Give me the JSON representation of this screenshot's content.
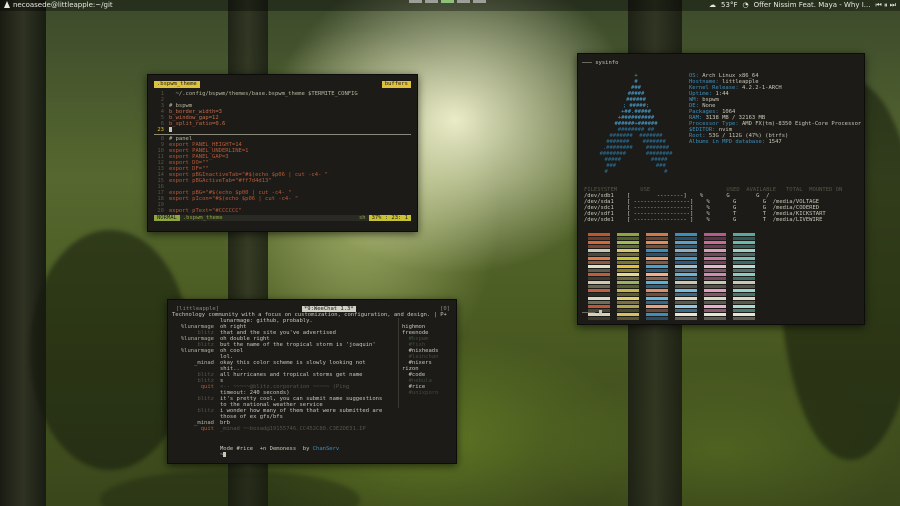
{
  "topbar": {
    "hostname": "necoasede@littleapple:~/git",
    "weather": "53°F",
    "now_playing": "Offer Nissim Feat. Maya - Why I...",
    "workspace_count": 5,
    "active_workspace": 3
  },
  "vim": {
    "tab": ".bspwm_theme",
    "buffers_label": "buffers",
    "lines": [
      {
        "n": "1",
        "t": "comment",
        "text": "  ~/.config/bspwm/themes/base.bspwm_theme $TERMITE_CONFIG"
      },
      {
        "n": "2",
        "t": "plain",
        "text": ""
      },
      {
        "n": "3",
        "t": "comment",
        "text": "# bspwm"
      },
      {
        "n": "4",
        "t": "var",
        "text": "b_border_width=3"
      },
      {
        "n": "5",
        "t": "var",
        "text": "b_window_gap=12"
      },
      {
        "n": "6",
        "t": "var",
        "text": "b_split_ratio=0.6"
      },
      {
        "n": "23",
        "t": "cursor",
        "text": ""
      },
      {
        "n": "8",
        "t": "comment",
        "text": "# panel"
      },
      {
        "n": "9",
        "t": "kw",
        "text": "export PANEL_HEIGHT=14"
      },
      {
        "n": "10",
        "t": "kw",
        "text": "export PANEL_UNDERLINE=1"
      },
      {
        "n": "11",
        "t": "kw",
        "text": "export PANEL_GAP=3"
      },
      {
        "n": "12",
        "t": "kw",
        "text": "export DO=\"\""
      },
      {
        "n": "13",
        "t": "kw",
        "text": "export DF=\"\""
      },
      {
        "n": "14",
        "t": "kw",
        "text": "export pBGInactiveTab=\"#$(echo $p06 | cut -c4- \""
      },
      {
        "n": "15",
        "t": "kw",
        "text": "export pBGActiveTab=\"#ff7d4d13\""
      },
      {
        "n": "16",
        "t": "plain",
        "text": ""
      },
      {
        "n": "17",
        "t": "kw",
        "text": "export pBG=\"#$(echo $p00 | cut -c4- \""
      },
      {
        "n": "18",
        "t": "kw",
        "text": "export pIcon=\"#$(echo $p06 | cut -c4- \""
      },
      {
        "n": "19",
        "t": "plain",
        "text": ""
      },
      {
        "n": "20",
        "t": "kw",
        "text": "export pText=\"#CCCCCC\""
      }
    ],
    "status": {
      "mode": "NORMAL",
      "file": ".bspwm_theme",
      "filetype": "sh",
      "position": "37% : 23: 1"
    }
  },
  "sysinfo": {
    "title": "─── sysinfo",
    "logo": [
      "+",
      "#",
      "###",
      "#####",
      "######",
      "; #####;",
      "+##.#####",
      "+##########",
      "######+######",
      "######## ##",
      "#######  #######",
      "#######    #######",
      ".########    #######",
      "########      ########",
      "#####         #####",
      "###            ###",
      "#                 #"
    ],
    "info": [
      {
        "k": "OS:",
        "v": "Arch Linux x86_64"
      },
      {
        "k": "Hostname:",
        "v": "littleapple"
      },
      {
        "k": "Kernel Release:",
        "v": "4.2.2-1-ARCH"
      },
      {
        "k": "Uptime:",
        "v": "1:44"
      },
      {
        "k": "WM:",
        "v": "bspwm"
      },
      {
        "k": "DE:",
        "v": "None"
      },
      {
        "k": "Packages:",
        "v": "1064"
      },
      {
        "k": "RAM:",
        "v": "3138 MB / 32163 MB"
      },
      {
        "k": "Processor Type:",
        "v": "AMD FX(tm)-8350 Eight-Core Processor"
      },
      {
        "k": "$EDITOR:",
        "v": "nvim"
      },
      {
        "k": "Root:",
        "v": "53G / 112G (47%) (btrfs)"
      },
      {
        "k": "Albums in MPD database:",
        "v": "1547"
      }
    ],
    "df_header": "FILESYSTEM       USE                       USED  AVAILABLE   TOTAL  MOUNTED ON",
    "df": [
      "/dev/sdb1    [        --------]    %       G        G  /",
      "/dev/sda1    [ -----------------]    %       G        G  /media/VOLTAGE",
      "/dev/sdc1    [ -----------------]    %       G        G  /media/CODERED",
      "/dev/sdf1    [ -----------------]    %       T        T  /media/KICKSTART",
      "/dev/sde1    [ ---------------- ]    %       G        T  /media/LIVEWIRE"
    ],
    "palette_columns": [
      [
        "#c0552e",
        "#6a3a2a",
        "#d06a3a",
        "#7a4432",
        "#c8c8b8",
        "#4a4a40",
        "#e07a4a",
        "#8a5a42",
        "#e4e0c8",
        "#5a5a4e",
        "#b86040",
        "#3c3a30",
        "#d0c8b0",
        "#6a6656",
        "#c06040",
        "#2e2c26",
        "#d8d8c4",
        "#706c5c",
        "#b85a3a",
        "#4a463a",
        "#d8d0b8",
        "#3a3a30"
      ],
      [
        "#8fa640",
        "#4e5e2a",
        "#a4b856",
        "#5c6e32",
        "#d8c870",
        "#6e6432",
        "#c9c232",
        "#7a7430",
        "#e0c13a",
        "#8a7a2c",
        "#e8d88a",
        "#6c6a3c",
        "#a0b060",
        "#56602e",
        "#c4b84a",
        "#5e5a2e",
        "#e0d070",
        "#7a7040",
        "#b0a850",
        "#4a4a2a",
        "#d8c060",
        "#5a5232"
      ],
      [
        "#d07a4a",
        "#6a4430",
        "#e08c5c",
        "#7a5038",
        "#3c8fbd",
        "#2a5070",
        "#e0a07a",
        "#805a44",
        "#4aa0cf",
        "#2e5a7c",
        "#f0b090",
        "#8a6450",
        "#5ab0d8",
        "#325e80",
        "#d89070",
        "#704c3c",
        "#66b8e0",
        "#386686",
        "#e0a488",
        "#6a4838",
        "#3c8fbd",
        "#2a4a66"
      ],
      [
        "#3c8fbd",
        "#24506e",
        "#5aa0c8",
        "#2c5c7c",
        "#8ab0c8",
        "#3a5468",
        "#4aa0cf",
        "#2e5a7c",
        "#a0c4d8",
        "#4a6478",
        "#6ab4dc",
        "#34627e",
        "#c8c8b8",
        "#54544a",
        "#78bce0",
        "#386684",
        "#d8d8c8",
        "#5a5a50",
        "#90c8e8",
        "#3e6a88",
        "#e4e4d4",
        "#606058"
      ],
      [
        "#b85a8a",
        "#5a3446",
        "#c86a9a",
        "#6a3c52",
        "#d8a0b8",
        "#6e4a5a",
        "#c87aa8",
        "#744458",
        "#e4b8cc",
        "#7c5464",
        "#d08ab4",
        "#7a4a60",
        "#c8c8b8",
        "#54544a",
        "#e0a0c4",
        "#84546a",
        "#d8d8c8",
        "#5a5a50",
        "#e8b0d0",
        "#8a5a70",
        "#e4e4d4",
        "#606058"
      ],
      [
        "#5aa8a0",
        "#2e5a56",
        "#6ab8b0",
        "#36625e",
        "#a0d0c8",
        "#4a6a66",
        "#78c0b8",
        "#3c6a66",
        "#b8dcd4",
        "#54706c",
        "#88ccc4",
        "#426e6a",
        "#c8c8b8",
        "#54544a",
        "#98d4cc",
        "#48746e",
        "#d8d8c8",
        "#5a5a50",
        "#a8dcd4",
        "#4e7a74",
        "#e4e4d4",
        "#606058"
      ]
    ]
  },
  "weechat": {
    "host": "[littleapple]",
    "buffer": "*9:WeeChat 1.3*",
    "window_num": "[0]",
    "topic": "Technology community with a focus on customization, configuration, and design. | P+",
    "messages": [
      {
        "nick": "",
        "cls": "lun",
        "msg": "lunarmage: github, probably."
      },
      {
        "nick": "%lunarmage",
        "cls": "lun",
        "msg": "oh right"
      },
      {
        "nick": "blitz",
        "cls": "dim",
        "msg": "that and the site you've advertised"
      },
      {
        "nick": "%lunarmage",
        "cls": "lun",
        "msg": "oh double right"
      },
      {
        "nick": "blitz",
        "cls": "dim",
        "msg": "but the name of the tropical storm is 'joaquin'"
      },
      {
        "nick": "%lunarmage",
        "cls": "lun",
        "msg": "oh cool"
      },
      {
        "nick": "",
        "cls": "lun",
        "msg": "lol."
      },
      {
        "nick": "_minad",
        "cls": "normal",
        "msg": "okay this color scheme is slowly looking not"
      },
      {
        "nick": "",
        "cls": "lun",
        "msg": "shit..."
      },
      {
        "nick": "blitz",
        "cls": "dim",
        "msg": "all hurricanes and tropical storms get name"
      },
      {
        "nick": "blitz",
        "cls": "dim",
        "msg": "s"
      },
      {
        "nick": "quit",
        "cls": "sys",
        "msg": "<-- ~~~~~@blitz.corporation ~~~~~ (Ping"
      },
      {
        "nick": "",
        "cls": "lun",
        "msg": "timeout: 240 seconds)"
      },
      {
        "nick": "blitz",
        "cls": "dim",
        "msg": "it's pretty cool, you can submit name suggestions"
      },
      {
        "nick": "",
        "cls": "lun",
        "msg": "to the national weather service"
      },
      {
        "nick": "blitz",
        "cls": "dim",
        "msg": "i wonder how many of them that were submitted are"
      },
      {
        "nick": "",
        "cls": "lun",
        "msg": "those of ex gfs/bfs"
      },
      {
        "nick": "_minad",
        "cls": "normal",
        "msg": "brb"
      },
      {
        "nick": "quit",
        "cls": "sys",
        "msg": "_minad ~~boxad@19155746.CC452C80.C3E2DE31.IP"
      },
      {
        "nick": "",
        "cls": "lun",
        "msg": ""
      }
    ],
    "nicklist": [
      {
        "t": "",
        "hi": false
      },
      {
        "t": "highmon",
        "hi": true
      },
      {
        "t": "freenode",
        "hi": true
      },
      {
        "t": "  #bspwm",
        "hi": false
      },
      {
        "t": "  #fish",
        "hi": false
      },
      {
        "t": "  #nixheads",
        "hi": true
      },
      {
        "t": "  #lainchan",
        "hi": false
      },
      {
        "t": "  #nixers",
        "hi": true
      },
      {
        "t": "rizon",
        "hi": true
      },
      {
        "t": "  #code",
        "hi": true
      },
      {
        "t": "  #nebula",
        "hi": false
      },
      {
        "t": "  #rice",
        "hi": true
      },
      {
        "t": "  #unixporn",
        "hi": false
      },
      {
        "t": "",
        "hi": false
      },
      {
        "t": "",
        "hi": false
      }
    ],
    "status_line": "Mode #rice  +n Demoness  by ",
    "status_server": "ChanServ",
    "input_prompt": "~"
  }
}
